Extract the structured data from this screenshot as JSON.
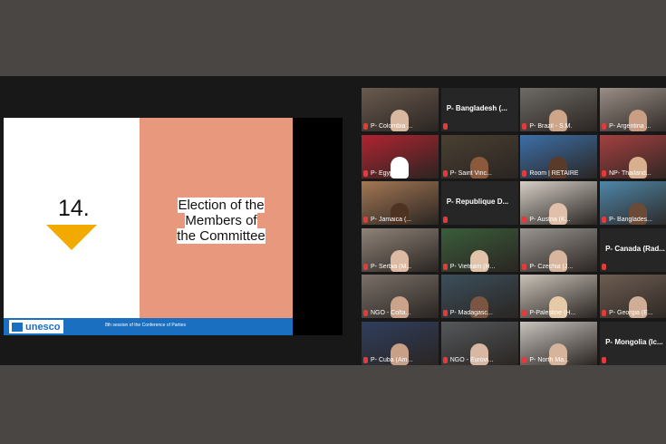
{
  "slide": {
    "number": "14.",
    "title_lines": [
      "Election of the",
      "Members of",
      "the Committee"
    ],
    "logo_text": "unesco",
    "session_text": "8th session of the Conference of Parties"
  },
  "participants": [
    {
      "label": "P- Colombia ...",
      "has_video": true,
      "color": "#6a5a4e",
      "skin": "#d9b8a0"
    },
    {
      "label": "P- Bangladesh (...",
      "has_video": false
    },
    {
      "label": "P- Brazil - S.M.",
      "has_video": true,
      "color": "#6e6a64",
      "skin": "#cfa58a"
    },
    {
      "label": "P- Argentina ...",
      "has_video": true,
      "color": "#9a8e86",
      "skin": "#c99e85"
    },
    {
      "label": "P- Egypt (A...",
      "has_video": true,
      "color": "#b02330",
      "skin": "#ffffff"
    },
    {
      "label": "P- Saint Vinc...",
      "has_video": true,
      "color": "#4a4032",
      "skin": "#8b5a3c"
    },
    {
      "label": "Room | RETAIRE",
      "has_video": true,
      "color": "#3d6fa8",
      "skin": "#5a3a28",
      "active": true
    },
    {
      "label": "NP- Thailand...",
      "has_video": true,
      "color": "#a44040",
      "skin": "#d8b08f"
    },
    {
      "label": "P- Jamaica (...",
      "has_video": true,
      "color": "#a37754",
      "skin": "#4e3222"
    },
    {
      "label": "P- Republique D...",
      "has_video": false
    },
    {
      "label": "P- Austria (K...",
      "has_video": true,
      "color": "#d6cfc7",
      "skin": "#e0c0aa"
    },
    {
      "label": "P- Banglades...",
      "has_video": true,
      "color": "#4f86a8",
      "skin": "#6b4a38"
    },
    {
      "label": "P- Serbia (M...",
      "has_video": true,
      "color": "#8f8378",
      "skin": "#dcbaa3"
    },
    {
      "label": "P- Vietnam (H...",
      "has_video": true,
      "color": "#3a5d3a",
      "skin": "#e0c3a8"
    },
    {
      "label": "P- Czechia (J...",
      "has_video": true,
      "color": "#9a9590",
      "skin": "#d8b69e"
    },
    {
      "label": "P- Canada (Rad...",
      "has_video": false
    },
    {
      "label": "NGO - Colta...",
      "has_video": true,
      "color": "#7a7068",
      "skin": "#caa38a"
    },
    {
      "label": "P- Madagasc...",
      "has_video": true,
      "color": "#3c4f5c",
      "skin": "#7a5642"
    },
    {
      "label": "P-Palestine (H...",
      "has_video": true,
      "color": "#c9c2b8",
      "skin": "#e6caa8"
    },
    {
      "label": "P- Georgia (E...",
      "has_video": true,
      "color": "#6e5d52",
      "skin": "#d0ad96"
    },
    {
      "label": "P- Cuba (Am...",
      "has_video": true,
      "color": "#2f3e5e",
      "skin": "#c8a088"
    },
    {
      "label": "NGO - Eurovi...",
      "has_video": true,
      "color": "#54585c",
      "skin": "#d8b8a2"
    },
    {
      "label": "P- North Ma...",
      "has_video": true,
      "color": "#c8c3bd",
      "skin": "#d6b49c"
    },
    {
      "label": "P- Mongolia (Ic...",
      "has_video": false
    }
  ]
}
